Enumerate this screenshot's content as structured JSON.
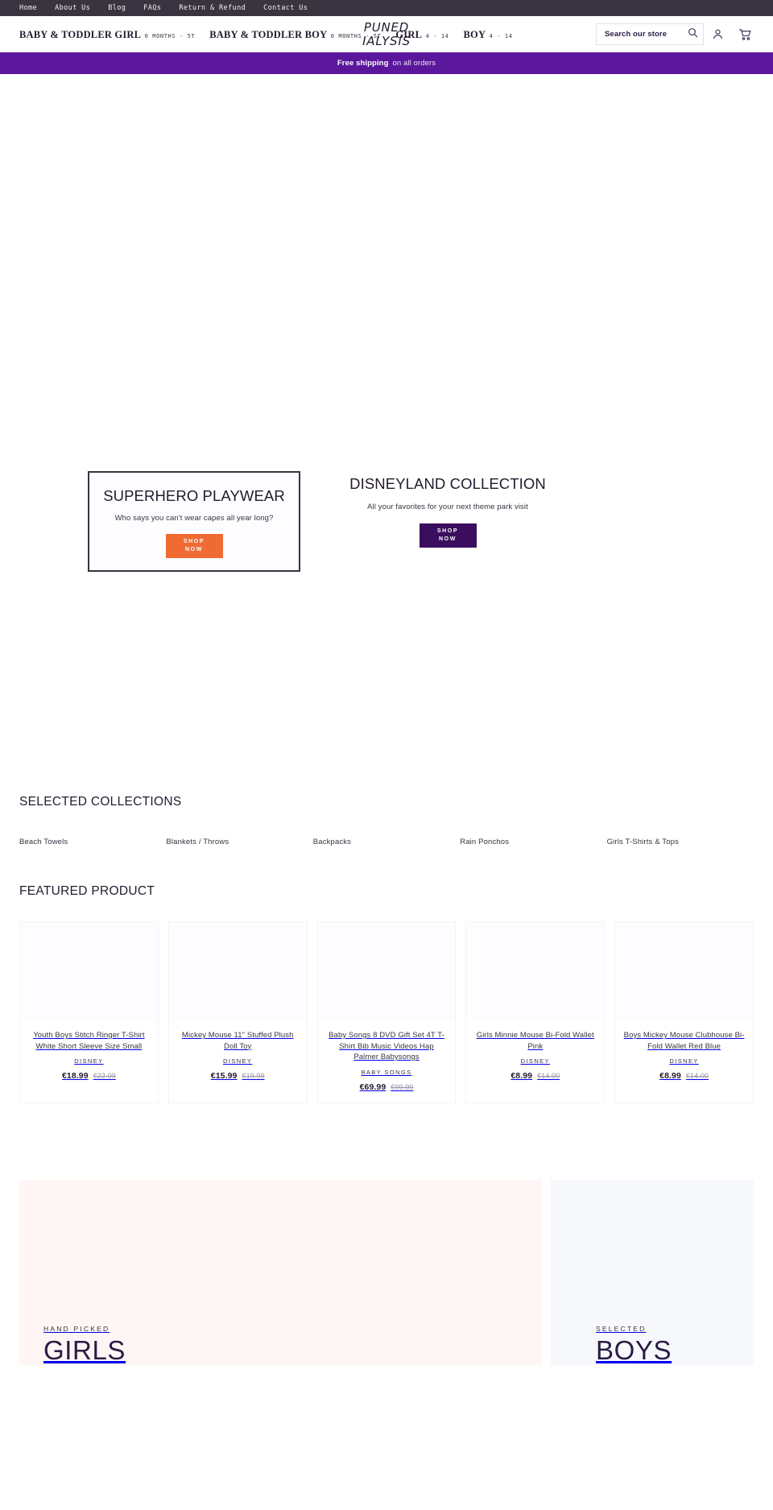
{
  "utility_nav": {
    "items": [
      {
        "label": "Home"
      },
      {
        "label": "About Us"
      },
      {
        "label": "Blog"
      },
      {
        "label": "FAQs"
      },
      {
        "label": "Return & Refund"
      },
      {
        "label": "Contact Us"
      }
    ]
  },
  "header": {
    "primary_nav": [
      {
        "title": "BABY & TODDLER GIRL",
        "sub": "0 MONTHS - 5T"
      },
      {
        "title": "BABY & TODDLER BOY",
        "sub": "0 MONTHS - 5T"
      },
      {
        "title": "GIRL",
        "sub": "4 - 14"
      },
      {
        "title": "BOY",
        "sub": "4 - 14"
      }
    ],
    "logo_line_1": "PUNED",
    "logo_line_2": "IALYSIS",
    "search_placeholder": "Search our store",
    "search_value": ""
  },
  "announcement": {
    "strong": "Free shipping",
    "text": "on all orders"
  },
  "hero": {
    "left": {
      "title": "SUPERHERO PLAYWEAR",
      "subtitle": "Who says you can't wear capes all year long?",
      "cta_line_1": "SHOP",
      "cta_line_2": "NOW",
      "cta_color": "#ef6b33"
    },
    "right": {
      "title": "DISNEYLAND COLLECTION",
      "subtitle": "All your favorites for your next theme park visit",
      "cta_line_1": "SHOP",
      "cta_line_2": "NOW",
      "cta_color": "#3b0d5e"
    }
  },
  "collections": {
    "heading": "SELECTED COLLECTIONS",
    "items": [
      {
        "label": "Beach Towels"
      },
      {
        "label": "Blankets / Throws"
      },
      {
        "label": "Backpacks"
      },
      {
        "label": "Rain Ponchos"
      },
      {
        "label": "Girls T-Shirts & Tops"
      }
    ]
  },
  "featured": {
    "heading": "FEATURED PRODUCT",
    "products": [
      {
        "name": "Youth Boys Stitch Ringer T-Shirt White Short Sleeve Size Small",
        "vendor": "DISNEY",
        "price": "€18.99",
        "compare_at": "€22.99"
      },
      {
        "name": "Mickey Mouse 11\" Stuffed Plush Doll Toy",
        "vendor": "DISNEY",
        "price": "€15.99",
        "compare_at": "€19.99"
      },
      {
        "name": "Baby Songs 8 DVD Gift Set 4T T-Shirt Bib Music Videos Hap Palmer Babysongs",
        "vendor": "BABY SONGS",
        "price": "€69.99",
        "compare_at": "€99.99"
      },
      {
        "name": "Girls Minnie Mouse Bi-Fold Wallet Pink",
        "vendor": "DISNEY",
        "price": "€8.99",
        "compare_at": "€14.00"
      },
      {
        "name": "Boys Mickey Mouse Clubhouse Bi-Fold Wallet Red Blue",
        "vendor": "DISNEY",
        "price": "€8.99",
        "compare_at": "€14.00"
      }
    ]
  },
  "promos": [
    {
      "kicker": "HAND PICKED",
      "title": "GIRLS",
      "background": "#fdf6f4"
    },
    {
      "kicker": "SELECTED",
      "title": "BOYS",
      "background": "#f7f8fc"
    }
  ]
}
